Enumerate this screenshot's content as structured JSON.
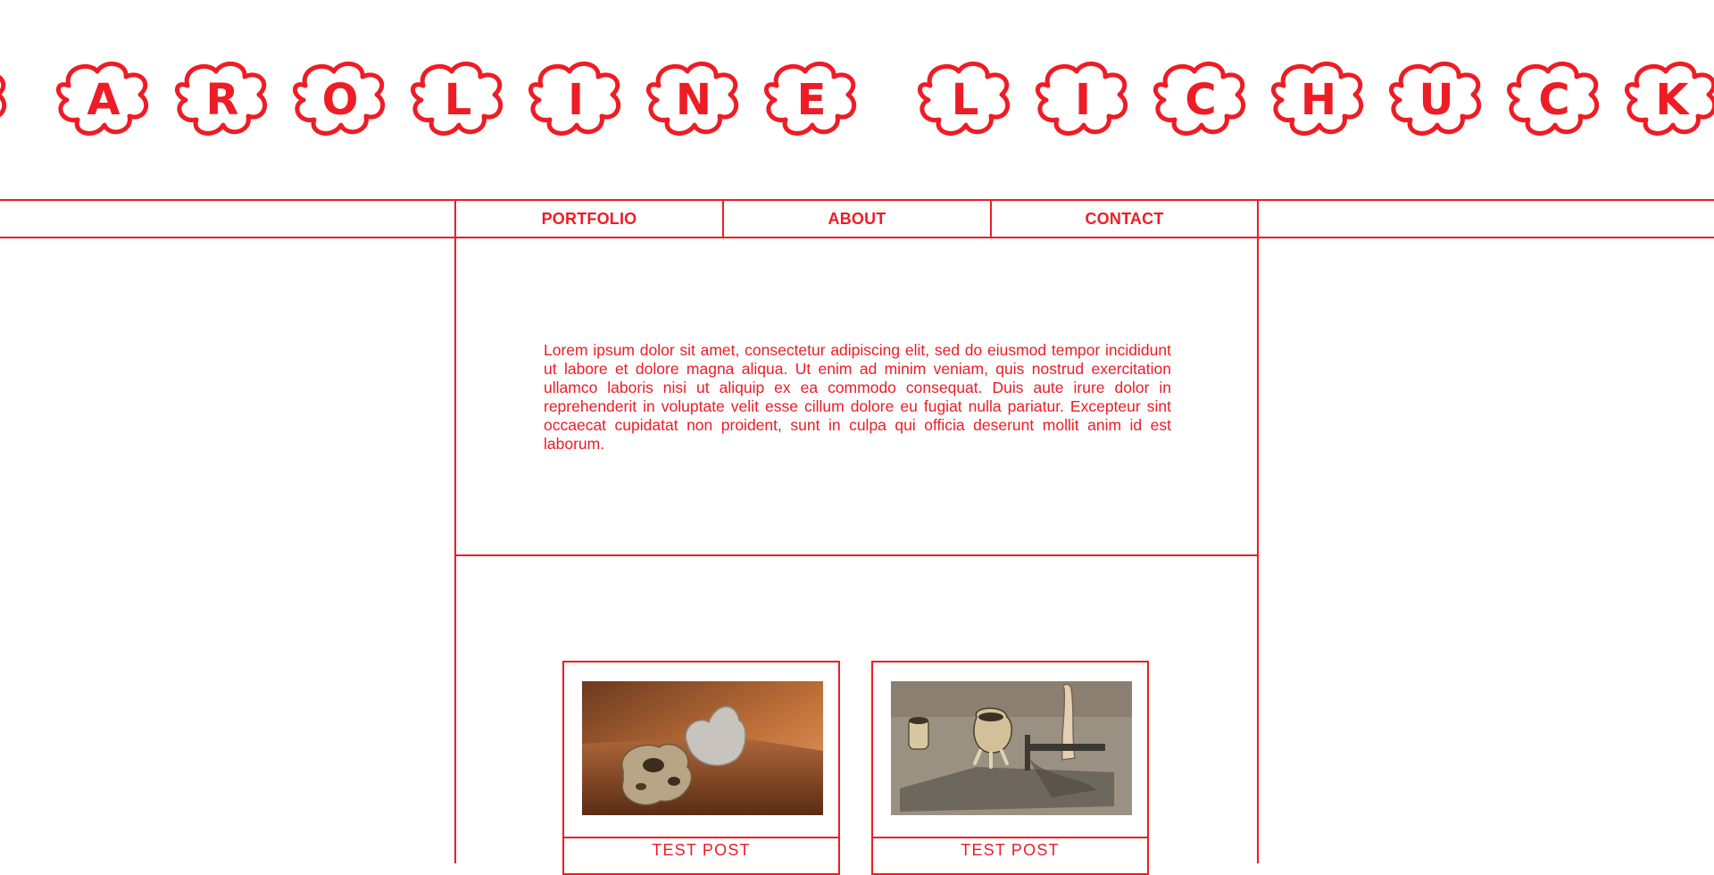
{
  "header": {
    "letters": [
      "C",
      "A",
      "R",
      "O",
      "L",
      "I",
      "N",
      "E",
      "L",
      "I",
      "C",
      "H",
      "U",
      "C",
      "K"
    ]
  },
  "nav": {
    "portfolio": "PORTFOLIO",
    "about": "ABOUT",
    "contact": "CONTACT"
  },
  "intro": {
    "text": "Lorem ipsum dolor sit amet, consectetur adipiscing elit, sed do eiusmod tempor incididunt ut labore et dolore magna aliqua. Ut enim ad minim veniam, quis nostrud exercitation ullamco laboris nisi ut aliquip ex ea commodo consequat. Duis aute irure dolor in reprehenderit in voluptate velit esse cillum dolore eu fugiat nulla pariatur. Excepteur sint occaecat cupidatat non proident, sunt in culpa qui officia deserunt mollit anim id est laborum."
  },
  "posts": [
    {
      "title": "TEST POST"
    },
    {
      "title": "TEST POST"
    }
  ],
  "colors": {
    "accent": "#ee1c25",
    "background": "#ffffff"
  }
}
